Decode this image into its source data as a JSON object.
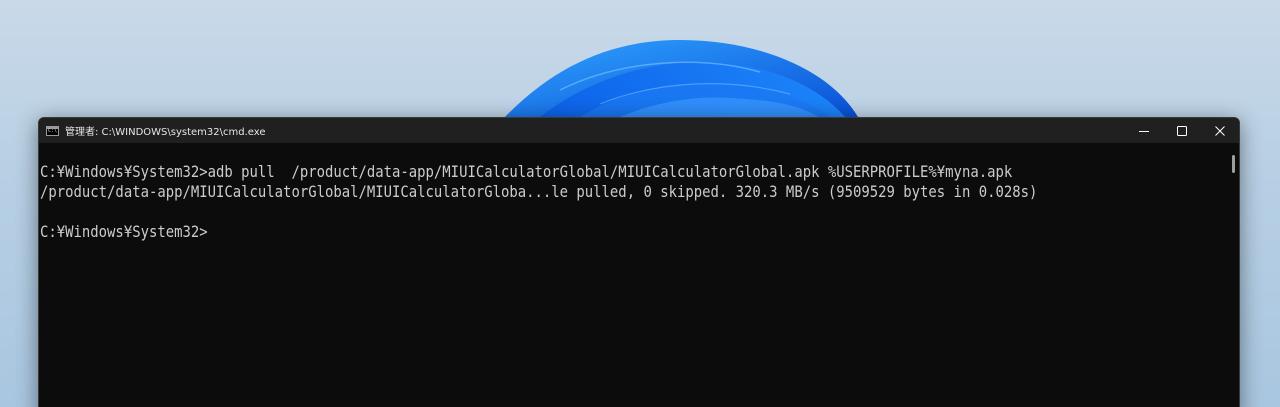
{
  "window": {
    "title": "管理者: C:\\WINDOWS\\system32\\cmd.exe",
    "controls": {
      "minimize_icon": "minimize-icon",
      "maximize_icon": "maximize-icon",
      "close_icon": "close-icon"
    }
  },
  "console": {
    "lines": [
      "C:¥Windows¥System32>adb pull  /product/data-app/MIUICalculatorGlobal/MIUICalculatorGlobal.apk %USERPROFILE%¥myna.apk",
      "/product/data-app/MIUICalculatorGlobal/MIUICalculatorGloba...le pulled, 0 skipped. 320.3 MB/s (9509529 bytes in 0.028s)",
      "",
      "C:¥Windows¥System32>"
    ]
  },
  "colors": {
    "console_bg": "#0c0c0c",
    "console_text": "#cccccc",
    "titlebar_bg": "#202020",
    "wallpaper_accent": "#1a73e8"
  }
}
